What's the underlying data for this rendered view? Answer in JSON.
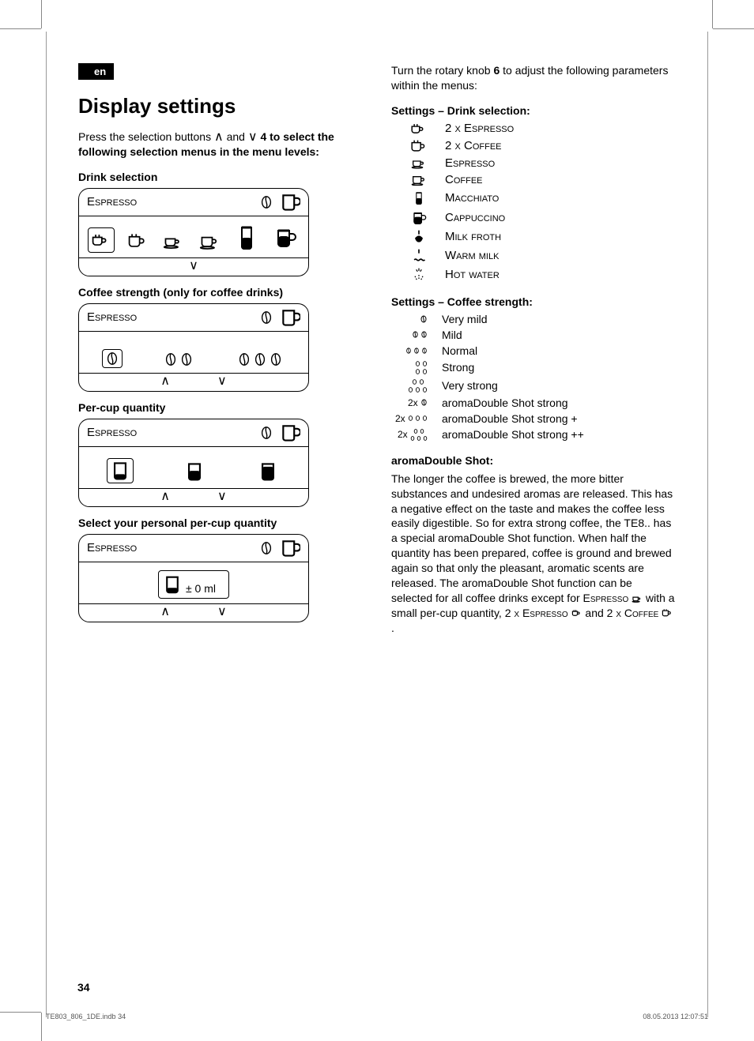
{
  "lang": "en",
  "title": "Display settings",
  "intro_pre": "Press the selection buttons ",
  "intro_mid": " and ",
  "intro_post": " 4 to select the following selection menus in the menu levels:",
  "sections": {
    "drink": "Drink selection",
    "strength": "Coffee strength (only for coffee drinks)",
    "percup": "Per-cup quantity",
    "personal": "Select your personal per-cup quantity"
  },
  "display_label": "Espresso",
  "ml_text": "± 0 ml",
  "right": {
    "intro_pre": "Turn the rotary knob ",
    "intro_knob": "6",
    "intro_post": " to adjust the following parameters within the menus:",
    "drink_header": "Settings – Drink selection:",
    "drinks": {
      "d1": "2 x Espresso",
      "d2": "2 x Coffee",
      "d3": "Espresso",
      "d4": "Coffee",
      "d5": "Macchiato",
      "d6": "Cappuccino",
      "d7": "Milk froth",
      "d8": "Warm milk",
      "d9": "Hot water"
    },
    "strength_header": "Settings – Coffee strength:",
    "strengths": {
      "s1": "Very mild",
      "s2": "Mild",
      "s3": "Normal",
      "s4": "Strong",
      "s5": "Very strong",
      "s6": "aromaDouble Shot strong",
      "s7": "aromaDouble Shot strong +",
      "s8": "aromaDouble Shot strong ++",
      "px1": "2x",
      "px2": "2x",
      "px3": "2x"
    },
    "ads_header": "aromaDouble Shot:",
    "ads_body": "The longer the coffee is brewed, the more bitter substances and undesired aromas are released. This has a negative effect on the taste and makes the coffee less easily digestible. So for extra strong coffee, the TE8.. has a special aromaDouble Shot function. When half the quantity has been prepared, coffee is ground and brewed again so that only the pleasant, aromatic scents are released. The aromaDouble Shot function can be selected for all coffee drinks except for ",
    "ads_e1": "Espresso",
    "ads_mid1": " with a small per-cup quantity, ",
    "ads_e2": "2 x Espresso",
    "ads_mid2": " and ",
    "ads_e3": "2 x Coffee",
    "ads_end": "."
  },
  "page_number": "34",
  "print_file": "TE803_806_1DE.indb   34",
  "print_ts": "08.05.2013   12:07:51"
}
